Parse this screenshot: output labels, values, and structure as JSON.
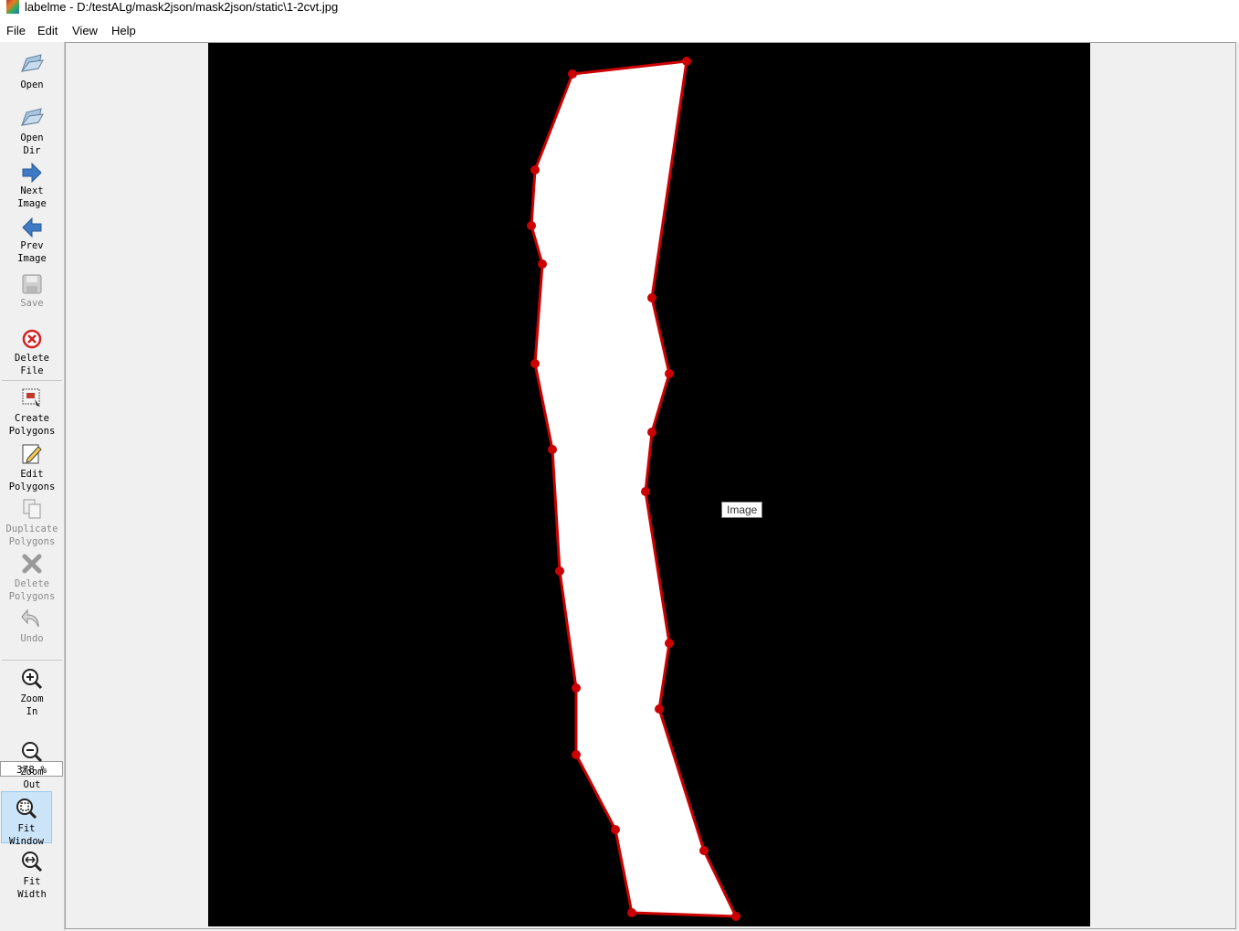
{
  "window": {
    "title": "labelme - D:/testALg/mask2json/mask2json/static\\1-2cvt.jpg"
  },
  "menu": [
    "File",
    "Edit",
    "View",
    "Help"
  ],
  "toolbar": {
    "open": "Open",
    "open_dir": "Open\nDir",
    "next_image": "Next\nImage",
    "prev_image": "Prev\nImage",
    "save": "Save",
    "delete_file": "Delete\nFile",
    "create_polygons": "Create\nPolygons",
    "edit_polygons": "Edit\nPolygons",
    "duplicate_polygons": "Duplicate\nPolygons",
    "delete_polygons": "Delete\nPolygons",
    "undo": "Undo",
    "zoom_in": "Zoom\nIn",
    "zoom_value": "378 %",
    "zoom_out": "Zoom\nOut",
    "fit_window": "Fit\nWindow",
    "fit_width": "Fit\nWidth"
  },
  "tooltip": "Image",
  "colors": {
    "polygon": "#cc0000",
    "fill": "#ffffff",
    "image_bg": "#000000"
  }
}
